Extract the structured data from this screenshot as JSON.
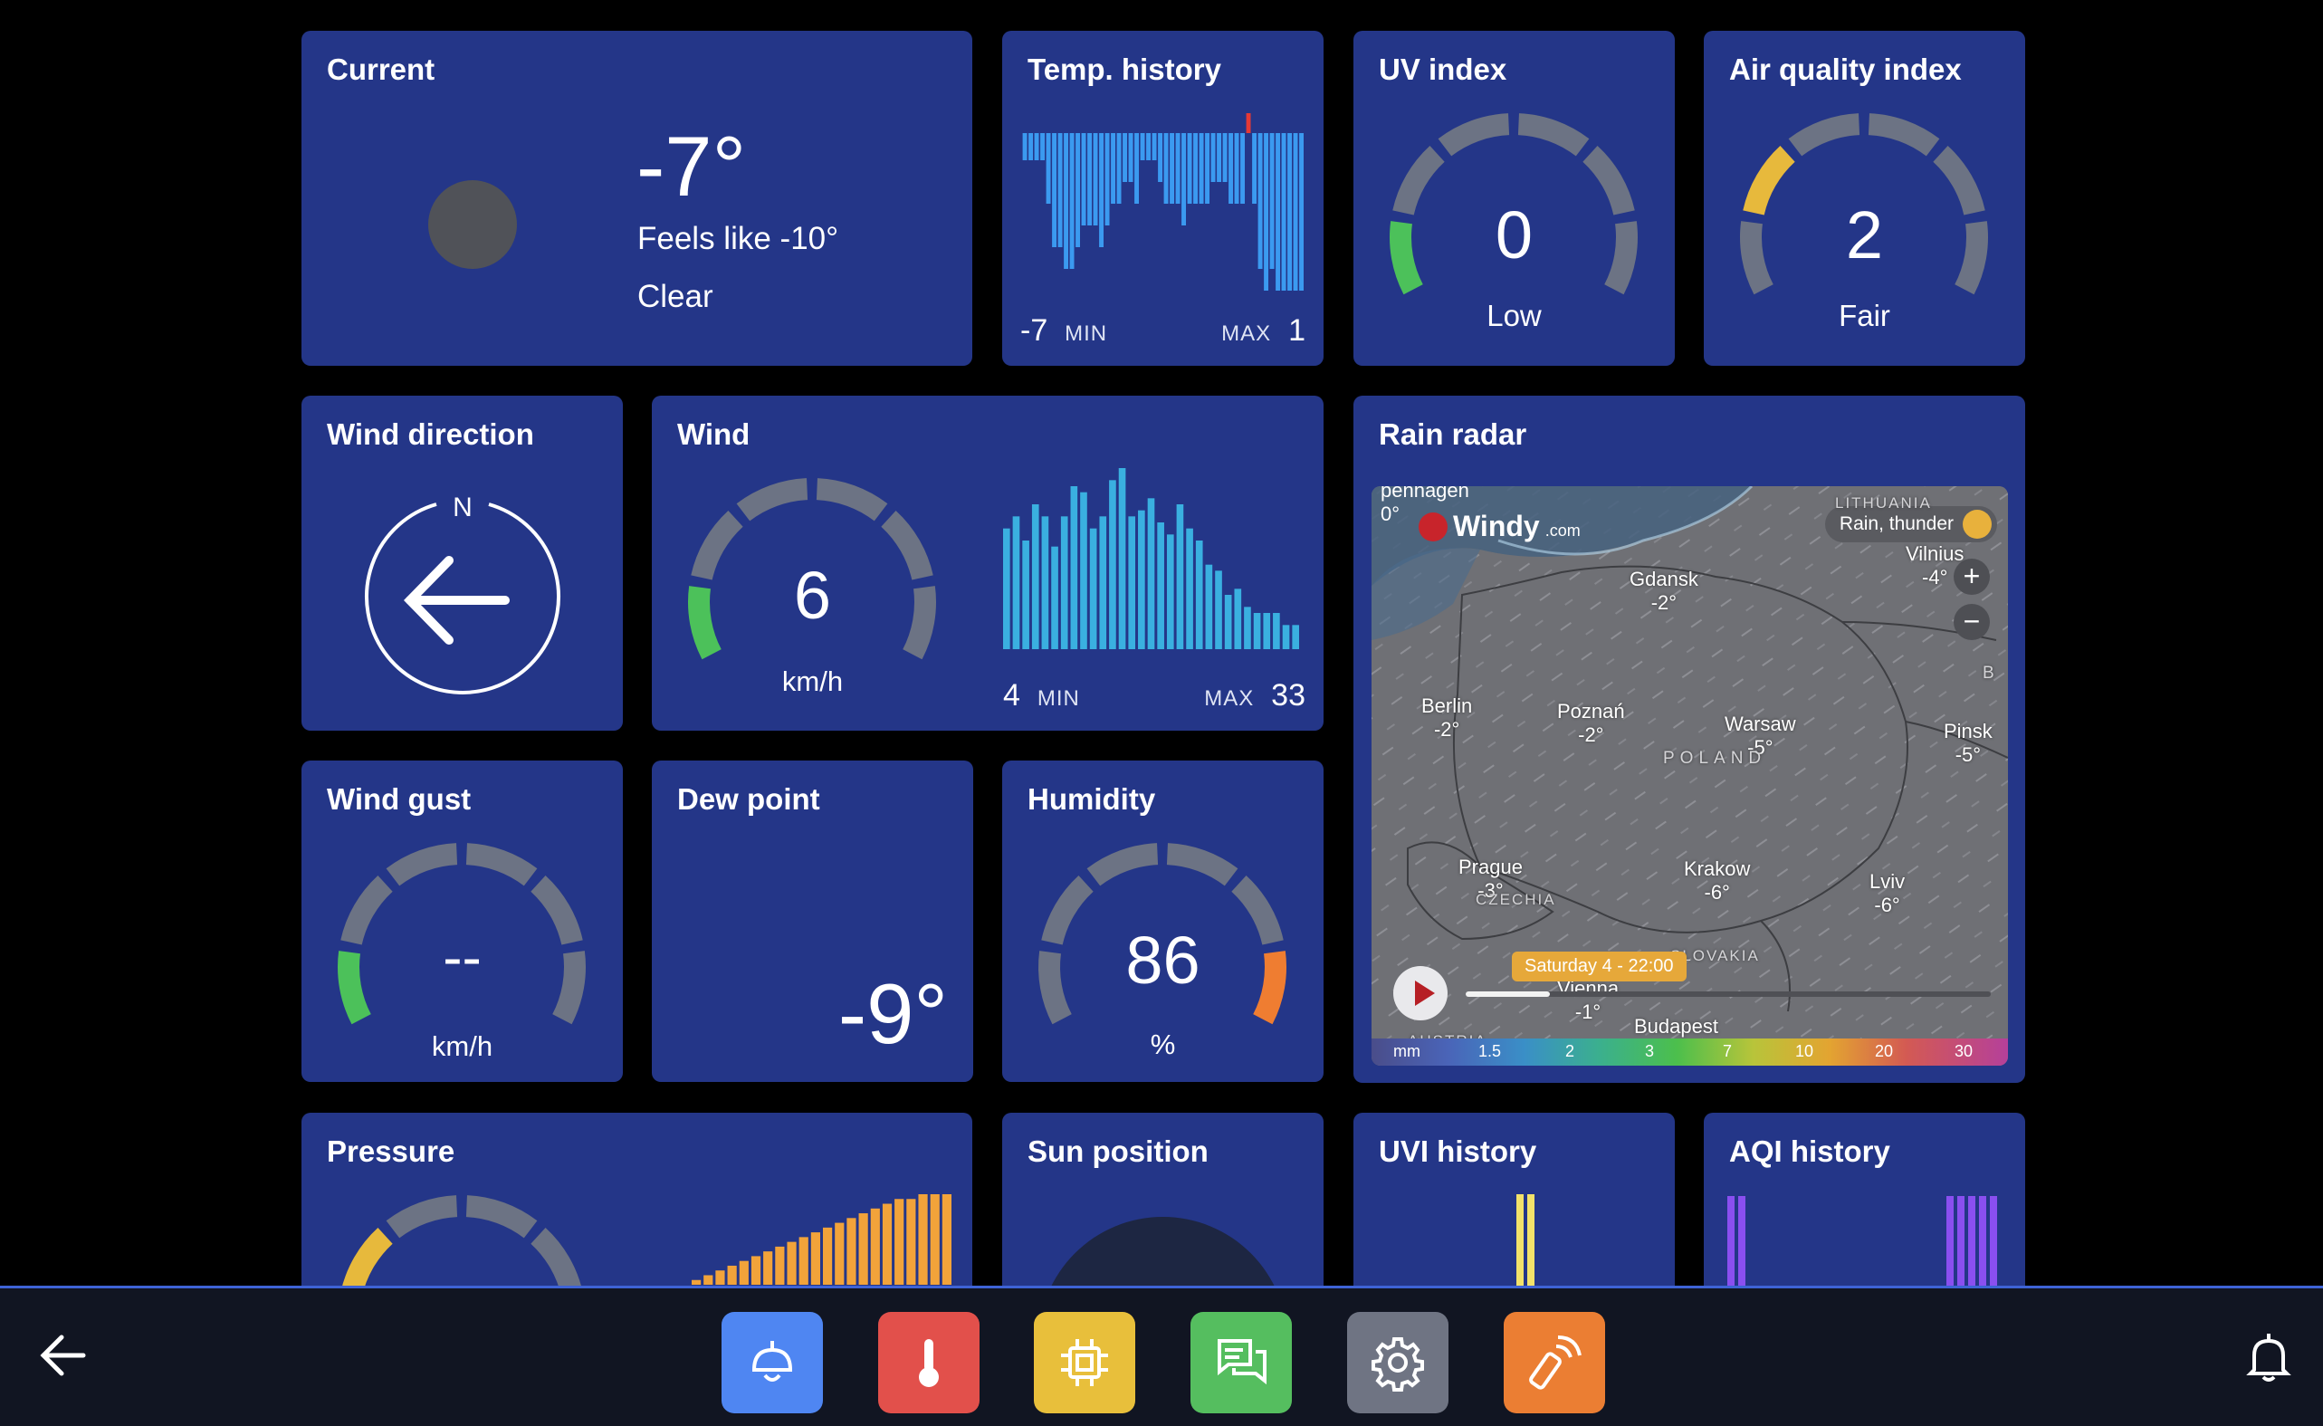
{
  "current": {
    "title": "Current",
    "temp": "-7°",
    "feels_like": "Feels like -10°",
    "condition": "Clear"
  },
  "temp_history": {
    "title": "Temp. history",
    "min": "-7",
    "min_label": "MIN",
    "max_label": "MAX",
    "max": "1",
    "bars": [
      -1,
      -1,
      -1,
      -1,
      -3,
      -5,
      -5,
      -6,
      -6,
      -5,
      -4,
      -4,
      -4,
      -5,
      -4,
      -3,
      -3,
      -2,
      -2,
      -3,
      -1,
      -1,
      -1,
      -2,
      -3,
      -3,
      -3,
      -4,
      -3,
      -3,
      -3,
      -3,
      -2,
      -2,
      -2,
      -3,
      -3,
      -3,
      1,
      -3,
      -6,
      -7,
      -6,
      -7,
      -7,
      -7,
      -7,
      -7
    ],
    "colors": {
      "negative": "#3b9af0",
      "positive": "#e53935"
    }
  },
  "uv": {
    "title": "UV index",
    "value": "0",
    "label": "Low",
    "level": 0
  },
  "aqi": {
    "title": "Air quality index",
    "value": "2",
    "label": "Fair",
    "level": 2
  },
  "wind_direction": {
    "title": "Wind direction",
    "north": "N",
    "icon": "arrow-left-icon"
  },
  "wind": {
    "title": "Wind",
    "value": "6",
    "unit": "km/h",
    "min": "4",
    "min_label": "MIN",
    "max_label": "MAX",
    "max": "33",
    "bars": [
      20,
      22,
      18,
      24,
      22,
      17,
      22,
      27,
      26,
      20,
      22,
      28,
      30,
      22,
      23,
      25,
      21,
      19,
      24,
      20,
      18,
      14,
      13,
      9,
      10,
      7,
      6,
      6,
      6,
      4,
      4
    ],
    "color": "#3ab0e0"
  },
  "radar": {
    "title": "Rain radar",
    "brand": "Windy",
    "brand_suffix": ".com",
    "layer": "Rain, thunder",
    "timestamp": "Saturday 4 - 22:00",
    "cities": [
      {
        "name": "Gdansk",
        "temp": "-2°"
      },
      {
        "name": "Vilnius",
        "temp": "-4°"
      },
      {
        "name": "Berlin",
        "temp": "-2°"
      },
      {
        "name": "Poznań",
        "temp": "-2°"
      },
      {
        "name": "Warsaw",
        "temp": "-5°"
      },
      {
        "name": "Pinsk",
        "temp": "-5°"
      },
      {
        "name": "Prague",
        "temp": "-3°"
      },
      {
        "name": "Krakow",
        "temp": "-6°"
      },
      {
        "name": "Lviv",
        "temp": "-6°"
      },
      {
        "name": "Budapest",
        "temp": ""
      },
      {
        "name": "Vienna",
        "temp": "-1°"
      }
    ],
    "regions": [
      "LITHUANIA",
      "POLAND",
      "CZECHIA",
      "AUSTRIA",
      "SLOVAKIA",
      "B"
    ],
    "topleft_place": "penhagen",
    "topleft_temp": "0°",
    "legend": [
      "mm",
      "1.5",
      "2",
      "3",
      "7",
      "10",
      "20",
      "30"
    ],
    "zoom_in": "+",
    "zoom_out": "−"
  },
  "wind_gust": {
    "title": "Wind gust",
    "value": "--",
    "unit": "km/h"
  },
  "dew_point": {
    "title": "Dew point",
    "value": "-9°"
  },
  "humidity": {
    "title": "Humidity",
    "value": "86",
    "unit": "%",
    "level": 86
  },
  "pressure": {
    "title": "Pressure",
    "bars": [
      1,
      2,
      3,
      4,
      5,
      6,
      7,
      8,
      9,
      10,
      11,
      12,
      13,
      14,
      15,
      16,
      17,
      18,
      18,
      19,
      19,
      19
    ],
    "color": "#f2a33a"
  },
  "sun": {
    "title": "Sun position"
  },
  "uvi_history": {
    "title": "UVI history",
    "color": "#f3e26a"
  },
  "aqi_history": {
    "title": "AQI history",
    "color": "#8a4ff0"
  },
  "taskbar": {
    "apps": [
      {
        "name": "lamp-app-button",
        "icon": "lamp-icon",
        "color": "#4f86f2"
      },
      {
        "name": "thermometer-app-button",
        "icon": "thermometer-icon",
        "color": "#e2504b"
      },
      {
        "name": "chip-app-button",
        "icon": "chip-icon",
        "color": "#e8bf3b"
      },
      {
        "name": "chat-app-button",
        "icon": "chat-icon",
        "color": "#55be5f"
      },
      {
        "name": "settings-app-button",
        "icon": "gear-icon",
        "color": "#6f7483"
      },
      {
        "name": "remote-app-button",
        "icon": "remote-icon",
        "color": "#eb7e33"
      }
    ]
  }
}
